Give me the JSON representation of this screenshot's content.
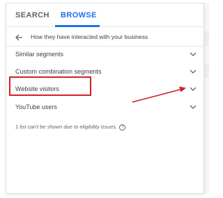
{
  "tabs": {
    "search_label": "SEARCH",
    "browse_label": "BROWSE",
    "active": "BROWSE"
  },
  "back_row": {
    "title": "How they have interacted with your business"
  },
  "items": [
    {
      "label": "Similar segments"
    },
    {
      "label": "Custom combination segments"
    },
    {
      "label": "Website visitors"
    },
    {
      "label": "YouTube users"
    }
  ],
  "note": {
    "text": "1 list can't be shown due to eligibility issues.",
    "icon": "help-icon"
  },
  "colors": {
    "accent": "#1a73e8",
    "annotation_red": "#d21f26"
  }
}
